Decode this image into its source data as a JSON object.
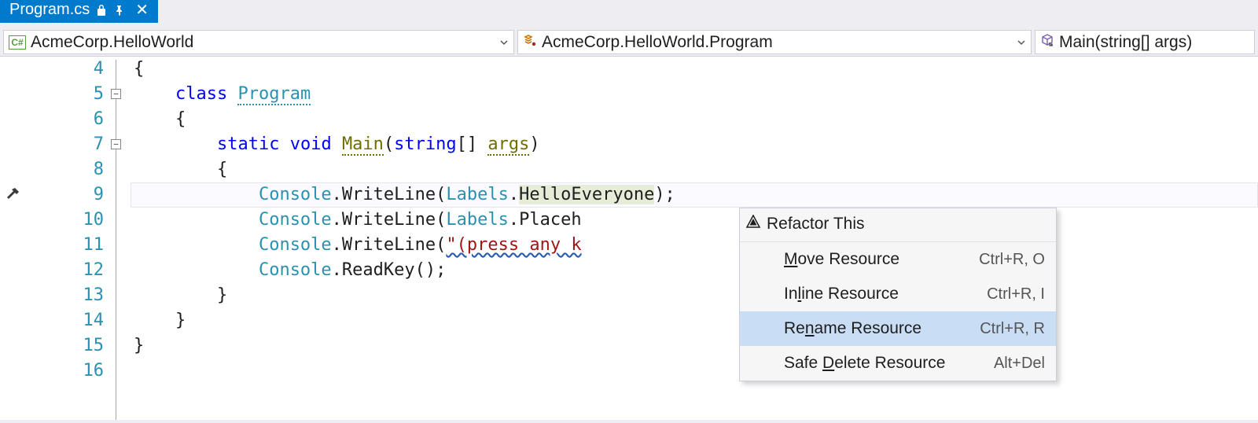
{
  "tab": {
    "filename": "Program.cs",
    "readonly_icon": "lock-icon",
    "pinned_icon": "pin-icon",
    "close_icon": "close-icon"
  },
  "navbar": {
    "namespace": "AcmeCorp.HelloWorld",
    "class": "AcmeCorp.HelloWorld.Program",
    "member": "Main(string[] args)"
  },
  "gutter": {
    "start": 4,
    "end": 16,
    "fold_lines": [
      5,
      7
    ],
    "current_line": 9
  },
  "code": {
    "l4": "{",
    "l5_kw": "class",
    "l5_type": "Program",
    "l6": "{",
    "l7_kw1": "static",
    "l7_kw2": "void",
    "l7_name": "Main",
    "l7_kw3": "string",
    "l7_args": "args",
    "l8": "{",
    "l9_type": "Console",
    "l9_method": "WriteLine",
    "l9_labels": "Labels",
    "l9_res": "HelloEveryone",
    "l10_type": "Console",
    "l10_method": "WriteLine",
    "l10_labels": "Labels",
    "l10_res": "Placeh",
    "l11_type": "Console",
    "l11_method": "WriteLine",
    "l11_str": "\"(press any k",
    "l12_type": "Console",
    "l12_method": "ReadKey",
    "l13": "}",
    "l14": "}",
    "l15": "}"
  },
  "popup": {
    "title": "Refactor This",
    "items": [
      {
        "label_pre": "",
        "label_u": "M",
        "label_post": "ove Resource",
        "shortcut": "Ctrl+R, O",
        "highlight": false
      },
      {
        "label_pre": "In",
        "label_u": "l",
        "label_post": "ine Resource",
        "shortcut": "Ctrl+R, I",
        "highlight": false
      },
      {
        "label_pre": "Re",
        "label_u": "n",
        "label_post": "ame Resource",
        "shortcut": "Ctrl+R, R",
        "highlight": true
      },
      {
        "label_pre": "Safe ",
        "label_u": "D",
        "label_post": "elete Resource",
        "shortcut": "Alt+Del",
        "highlight": false
      }
    ]
  }
}
